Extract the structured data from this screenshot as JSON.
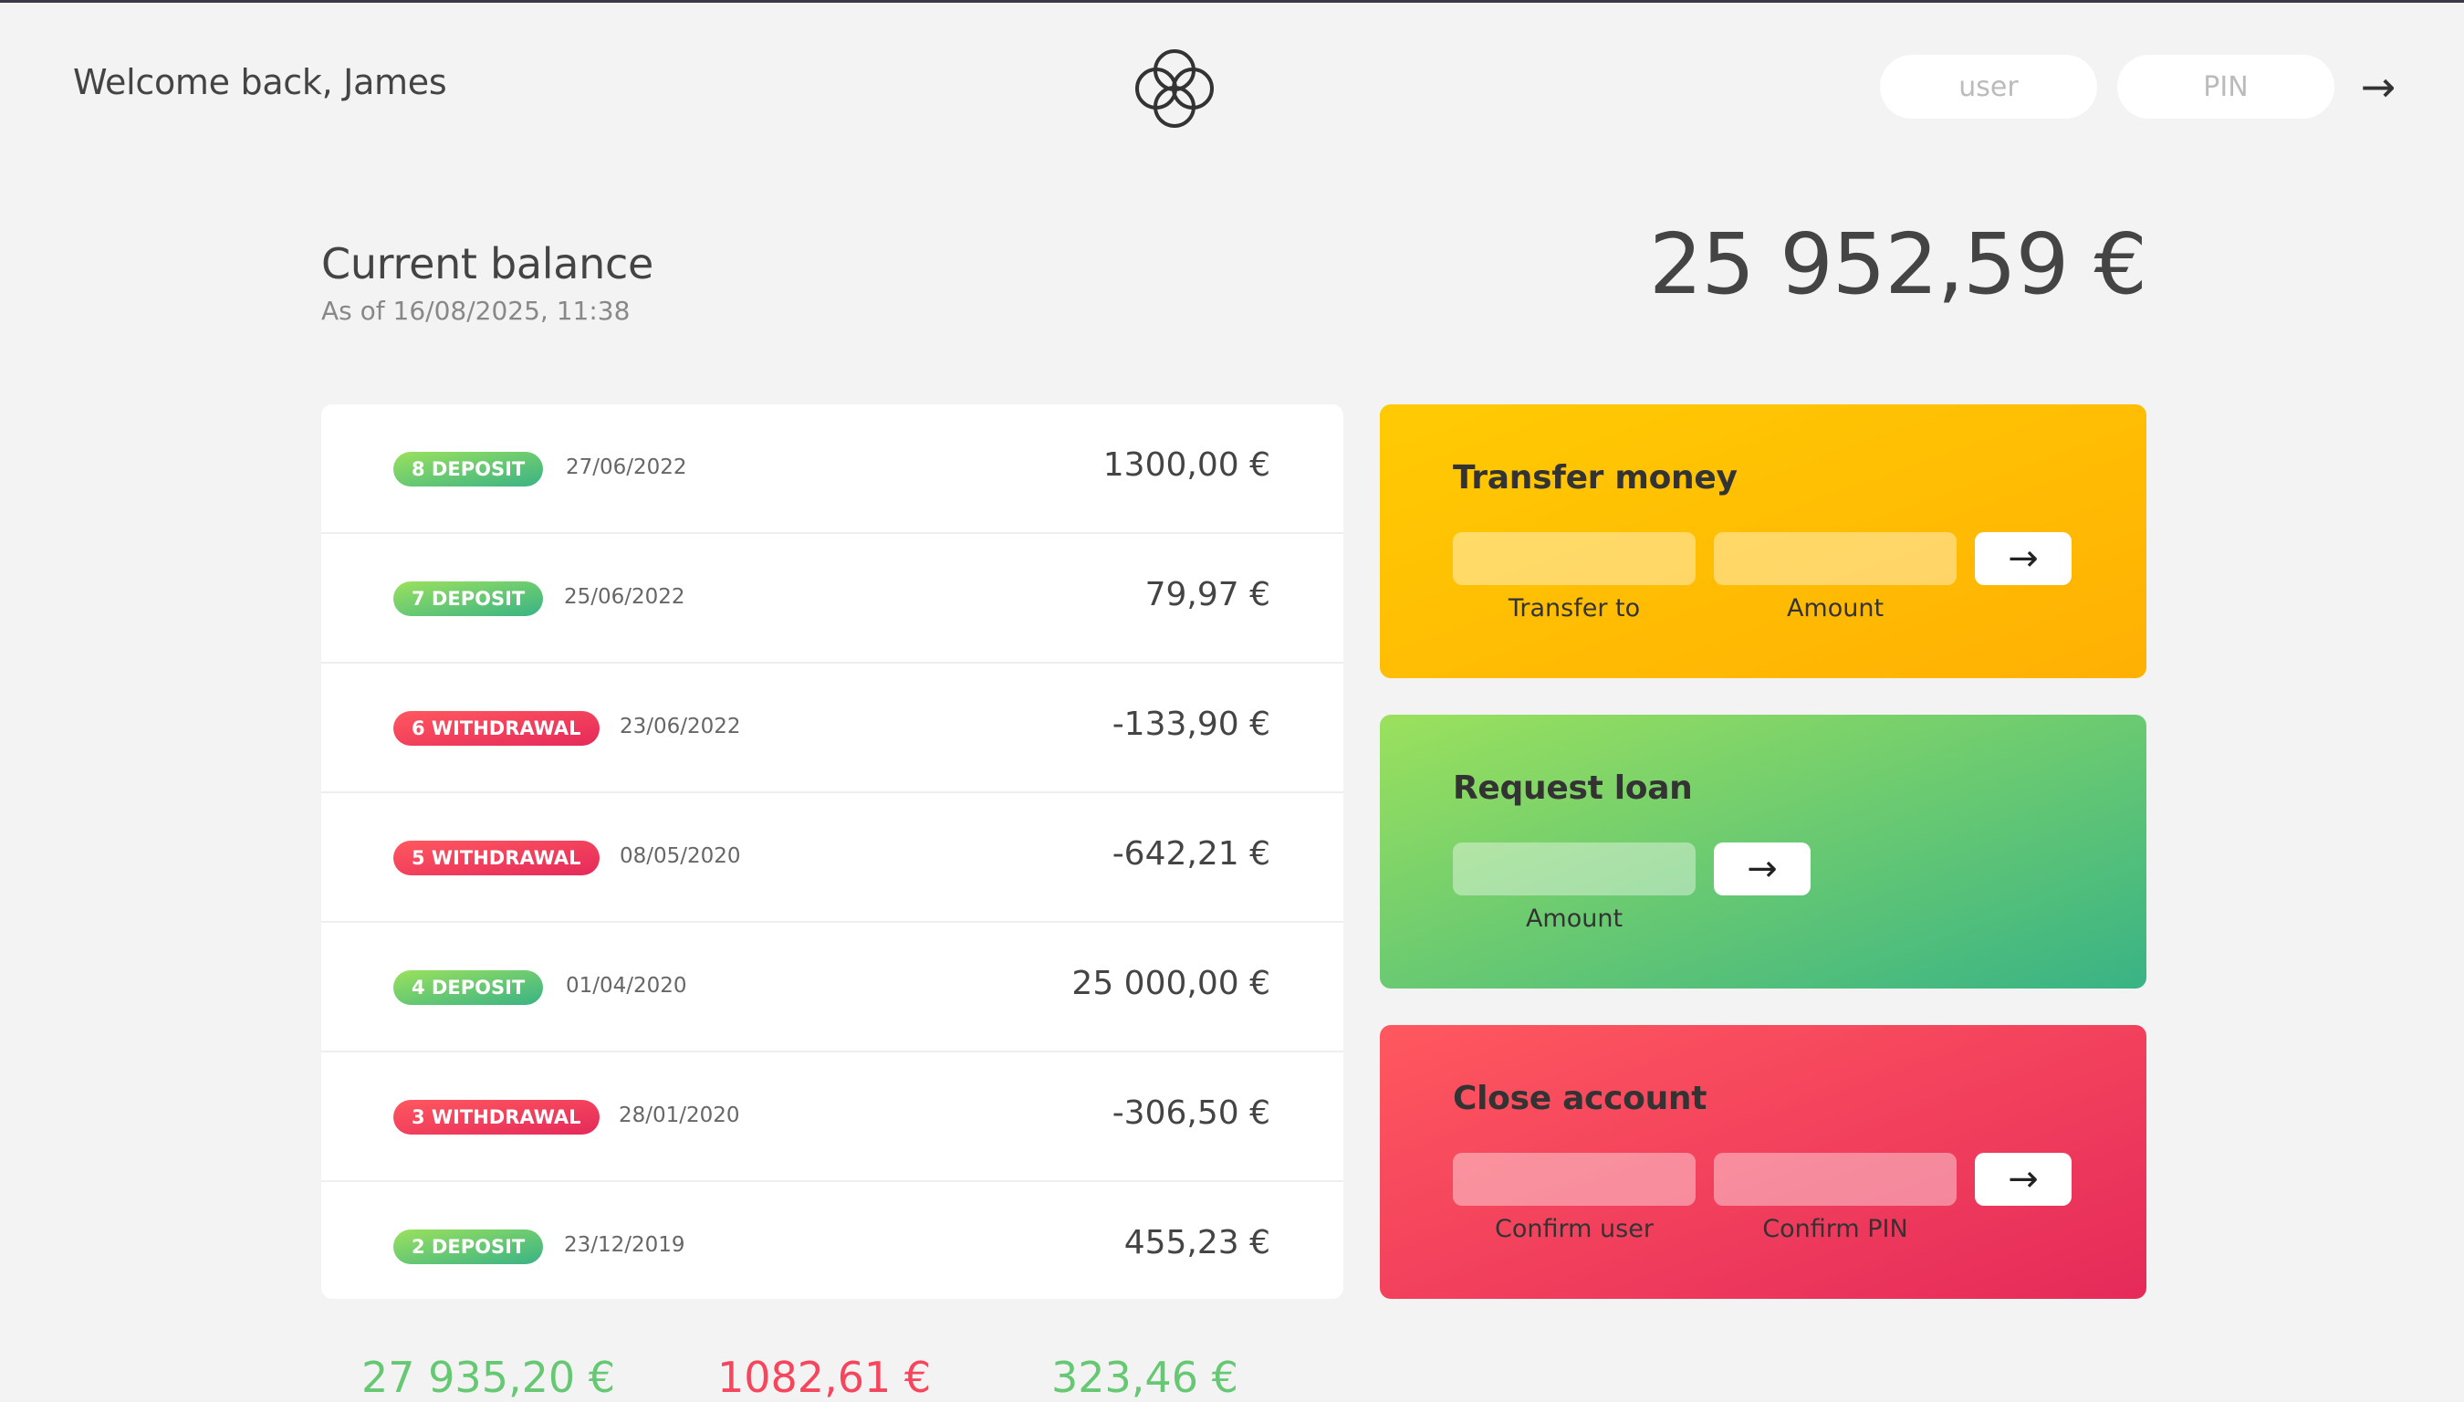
{
  "nav": {
    "welcome": "Welcome back, James",
    "user_placeholder": "user",
    "pin_placeholder": "PIN",
    "login_arrow": "→"
  },
  "balance": {
    "label": "Current balance",
    "date": "As of 16/08/2025, 11:38",
    "value": "25 952,59 €"
  },
  "movements": [
    {
      "type": "8 DEPOSIT",
      "kind": "deposit",
      "date": "27/06/2022",
      "value": "1300,00 €"
    },
    {
      "type": "7 DEPOSIT",
      "kind": "deposit",
      "date": "25/06/2022",
      "value": "79,97 €"
    },
    {
      "type": "6 WITHDRAWAL",
      "kind": "withdrawal",
      "date": "23/06/2022",
      "value": "-133,90 €"
    },
    {
      "type": "5 WITHDRAWAL",
      "kind": "withdrawal",
      "date": "08/05/2020",
      "value": "-642,21 €"
    },
    {
      "type": "4 DEPOSIT",
      "kind": "deposit",
      "date": "01/04/2020",
      "value": "25 000,00 €"
    },
    {
      "type": "3 WITHDRAWAL",
      "kind": "withdrawal",
      "date": "28/01/2020",
      "value": "-306,50 €"
    },
    {
      "type": "2 DEPOSIT",
      "kind": "deposit",
      "date": "23/12/2019",
      "value": "455,23 €"
    }
  ],
  "operations": {
    "transfer": {
      "title": "Transfer money",
      "to_label": "Transfer to",
      "amount_label": "Amount",
      "button": "→"
    },
    "loan": {
      "title": "Request loan",
      "amount_label": "Amount",
      "button": "→"
    },
    "close": {
      "title": "Close account",
      "user_label": "Confirm user",
      "pin_label": "Confirm PIN",
      "button": "→"
    }
  },
  "summary": {
    "in": "27 935,20 €",
    "out": "1082,61 €",
    "interest": "323,46 €"
  },
  "colors": {
    "deposit_gradient": [
      "#9be15d",
      "#39b385"
    ],
    "withdrawal_gradient": [
      "#ff585f",
      "#e52a5a"
    ],
    "transfer_gradient": [
      "#ffcb03",
      "#ffb003"
    ],
    "background": "#f3f3f3"
  }
}
